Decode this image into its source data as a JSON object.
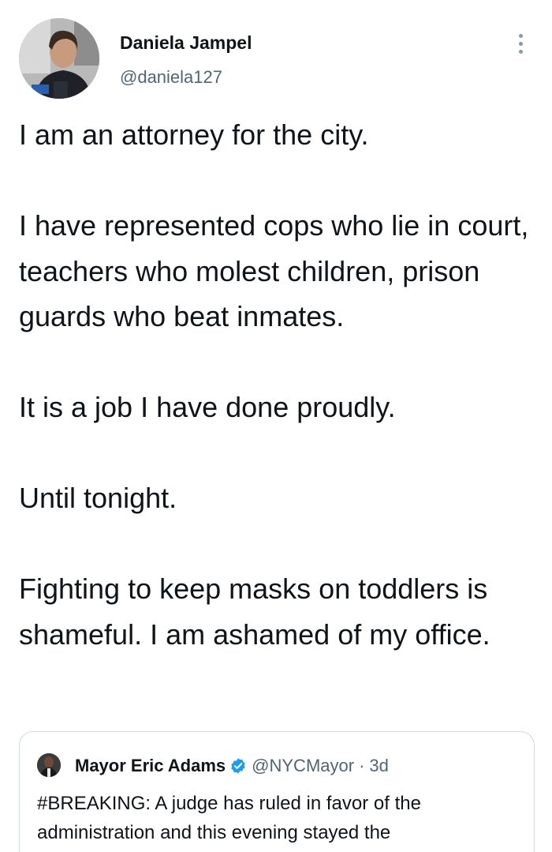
{
  "tweet": {
    "author": {
      "name": "Daniela Jampel",
      "handle": "@daniela127"
    },
    "paragraphs": [
      "I am an attorney for the city.",
      "I have represented cops who lie in court, teachers who molest children, prison guards who beat inmates.",
      "It is a job I have done proudly.",
      "Until tonight.",
      "Fighting to keep masks on toddlers is shameful. I am ashamed of my office."
    ],
    "more_icon": "more-vertical-icon"
  },
  "quoted_tweet": {
    "author_name": "Mayor Eric Adams",
    "verified_icon": "verified-badge-icon",
    "handle": "@NYCMayor",
    "separator": "·",
    "time": "3d",
    "text": "#BREAKING: A judge has ruled in favor of the administration and this evening stayed the"
  },
  "colors": {
    "text": "#0f1419",
    "secondary": "#536471",
    "verified": "#1d9bf0",
    "border": "#cfd9de"
  }
}
